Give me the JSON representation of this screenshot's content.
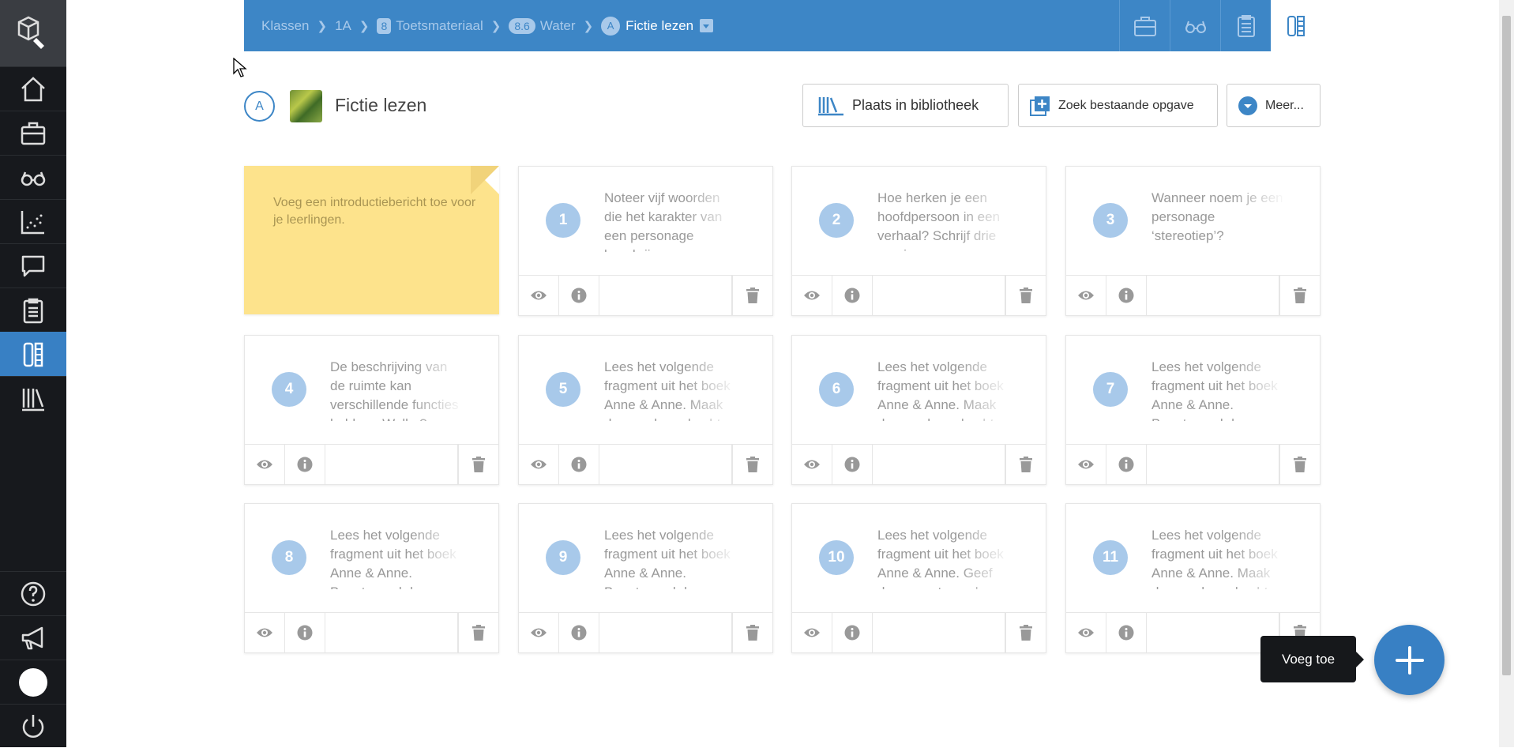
{
  "breadcrumb": {
    "items": [
      {
        "label": "Klassen"
      },
      {
        "label": "1A"
      },
      {
        "badge": "8",
        "label": "Toetsmateriaal"
      },
      {
        "badge": "8.6",
        "label": "Water"
      }
    ],
    "current": {
      "badge": "A",
      "label": "Fictie lezen"
    }
  },
  "header": {
    "badge": "A",
    "title": "Fictie lezen",
    "buttons": {
      "library": "Plaats in bibliotheek",
      "search": "Zoek bestaande opgave",
      "more": "Meer..."
    }
  },
  "intro_note": "Voeg een introductiebericht toe voor je leerlingen.",
  "questions": [
    {
      "number": "1",
      "text": "Noteer vijf woorden die het karakter van een personage beschrijven."
    },
    {
      "number": "2",
      "text": "Hoe herken je een hoofdpersoon in een verhaal? Schrijf drie manieren op."
    },
    {
      "number": "3",
      "text": "Wanneer noem je een personage ‘stereotiep’?"
    },
    {
      "number": "4",
      "text": "De beschrijving van de ruimte kan verschillende functies hebben. Welke?"
    },
    {
      "number": "5",
      "text": "Lees het volgende fragment uit het boek Anne & Anne. Maak daarna de opdracht."
    },
    {
      "number": "6",
      "text": "Lees het volgende fragment uit het boek Anne & Anne. Maak daarna de opdracht."
    },
    {
      "number": "7",
      "text": "Lees het volgende fragment uit het boek Anne & Anne. Beantwoord de vragen."
    },
    {
      "number": "8",
      "text": "Lees het volgende fragment uit het boek Anne & Anne. Beantwoord de vragen."
    },
    {
      "number": "9",
      "text": "Lees het volgende fragment uit het boek Anne & Anne. Beantwoord de vragen."
    },
    {
      "number": "10",
      "text": "Lees het volgende fragment uit het boek Anne & Anne. Geef daarna antwoord."
    },
    {
      "number": "11",
      "text": "Lees het volgende fragment uit het boek Anne & Anne. Maak daarna de opdracht."
    }
  ],
  "add_tooltip": "Voeg toe",
  "colors": {
    "primary": "#3d86c6",
    "sidebar": "#17191d",
    "active_nav": "#3880c4",
    "note": "#fde38c",
    "number_badge": "#a8c9ea"
  },
  "icons": {
    "sidebar": [
      "logo-icon",
      "home-icon",
      "briefcase-icon",
      "glasses-icon",
      "chart-icon",
      "chat-icon",
      "clipboard-icon",
      "tasks-icon",
      "library-icon",
      "help-icon",
      "megaphone-icon",
      "avatar",
      "power-icon"
    ],
    "topbar": [
      "briefcase-icon",
      "glasses-icon",
      "clipboard-icon",
      "tasks-icon"
    ],
    "card_actions": [
      "eye-icon",
      "info-icon",
      "trash-icon"
    ]
  }
}
